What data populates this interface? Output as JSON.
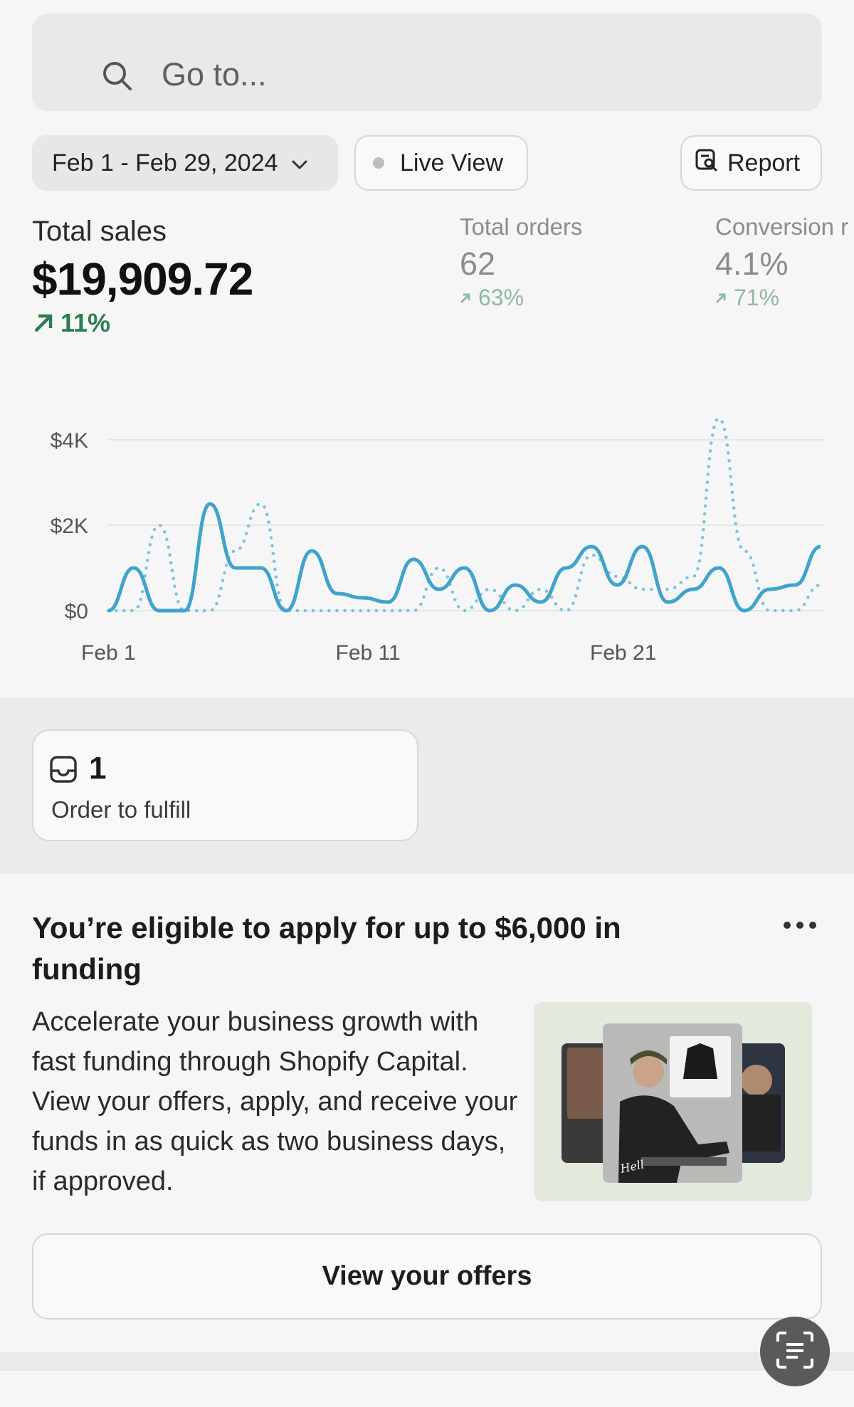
{
  "search": {
    "placeholder": "Go to..."
  },
  "filters": {
    "date_range": "Feb 1 - Feb 29, 2024",
    "live_view": "Live View",
    "report": "Report"
  },
  "metrics": {
    "total_sales": {
      "label": "Total sales",
      "value": "$19,909.72",
      "change": "11%"
    },
    "total_orders": {
      "label": "Total orders",
      "value": "62",
      "change": "63%"
    },
    "conversion": {
      "label": "Conversion r",
      "value": "4.1%",
      "change": "71%"
    }
  },
  "chart_data": {
    "type": "line",
    "y_ticks": [
      "$4K",
      "$2K",
      "$0"
    ],
    "x_ticks": [
      "Feb 1",
      "Feb 11",
      "Feb 21"
    ],
    "ylim": [
      0,
      4500
    ],
    "grid": true,
    "series": [
      {
        "style": "solid",
        "color": "#3fa3cc",
        "values": [
          0,
          1000,
          0,
          0,
          2500,
          1000,
          1000,
          0,
          1400,
          400,
          300,
          200,
          1200,
          500,
          1000,
          0,
          600,
          200,
          1000,
          1500,
          600,
          1500,
          200,
          500,
          1000,
          0,
          500,
          600,
          1500
        ]
      },
      {
        "style": "dotted",
        "color": "#7cc4d8",
        "values": [
          0,
          0,
          2000,
          0,
          0,
          1400,
          2500,
          0,
          0,
          0,
          0,
          0,
          0,
          1000,
          0,
          500,
          0,
          500,
          0,
          1300,
          800,
          500,
          500,
          800,
          4500,
          1400,
          0,
          0,
          600
        ]
      }
    ]
  },
  "fulfill": {
    "count": "1",
    "label": "Order to fulfill"
  },
  "funding": {
    "title": "You’re eligible to apply for up to $6,000 in funding",
    "body": "Accelerate your business growth with fast funding through Shopify Capital. View your offers, apply, and receive your funds in as quick as two business days, if approved.",
    "button": "View your offers"
  },
  "colors": {
    "positive": "#2e7d4f",
    "chart_primary": "#3fa3cc",
    "chart_secondary": "#7cc4d8"
  }
}
